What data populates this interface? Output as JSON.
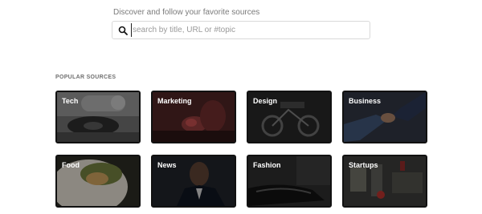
{
  "header": {
    "subtitle": "Discover and follow your favorite sources"
  },
  "search": {
    "placeholder": "search by title, URL or #topic",
    "value": "",
    "icon": "search-icon"
  },
  "popular": {
    "heading": "POPULAR SOURCES",
    "tiles": [
      {
        "label": "Tech"
      },
      {
        "label": "Marketing"
      },
      {
        "label": "Design"
      },
      {
        "label": "Business"
      },
      {
        "label": "Food"
      },
      {
        "label": "News"
      },
      {
        "label": "Fashion"
      },
      {
        "label": "Startups"
      }
    ]
  },
  "colors": {
    "tile_border": "#111111",
    "label_text": "#ffffff"
  }
}
